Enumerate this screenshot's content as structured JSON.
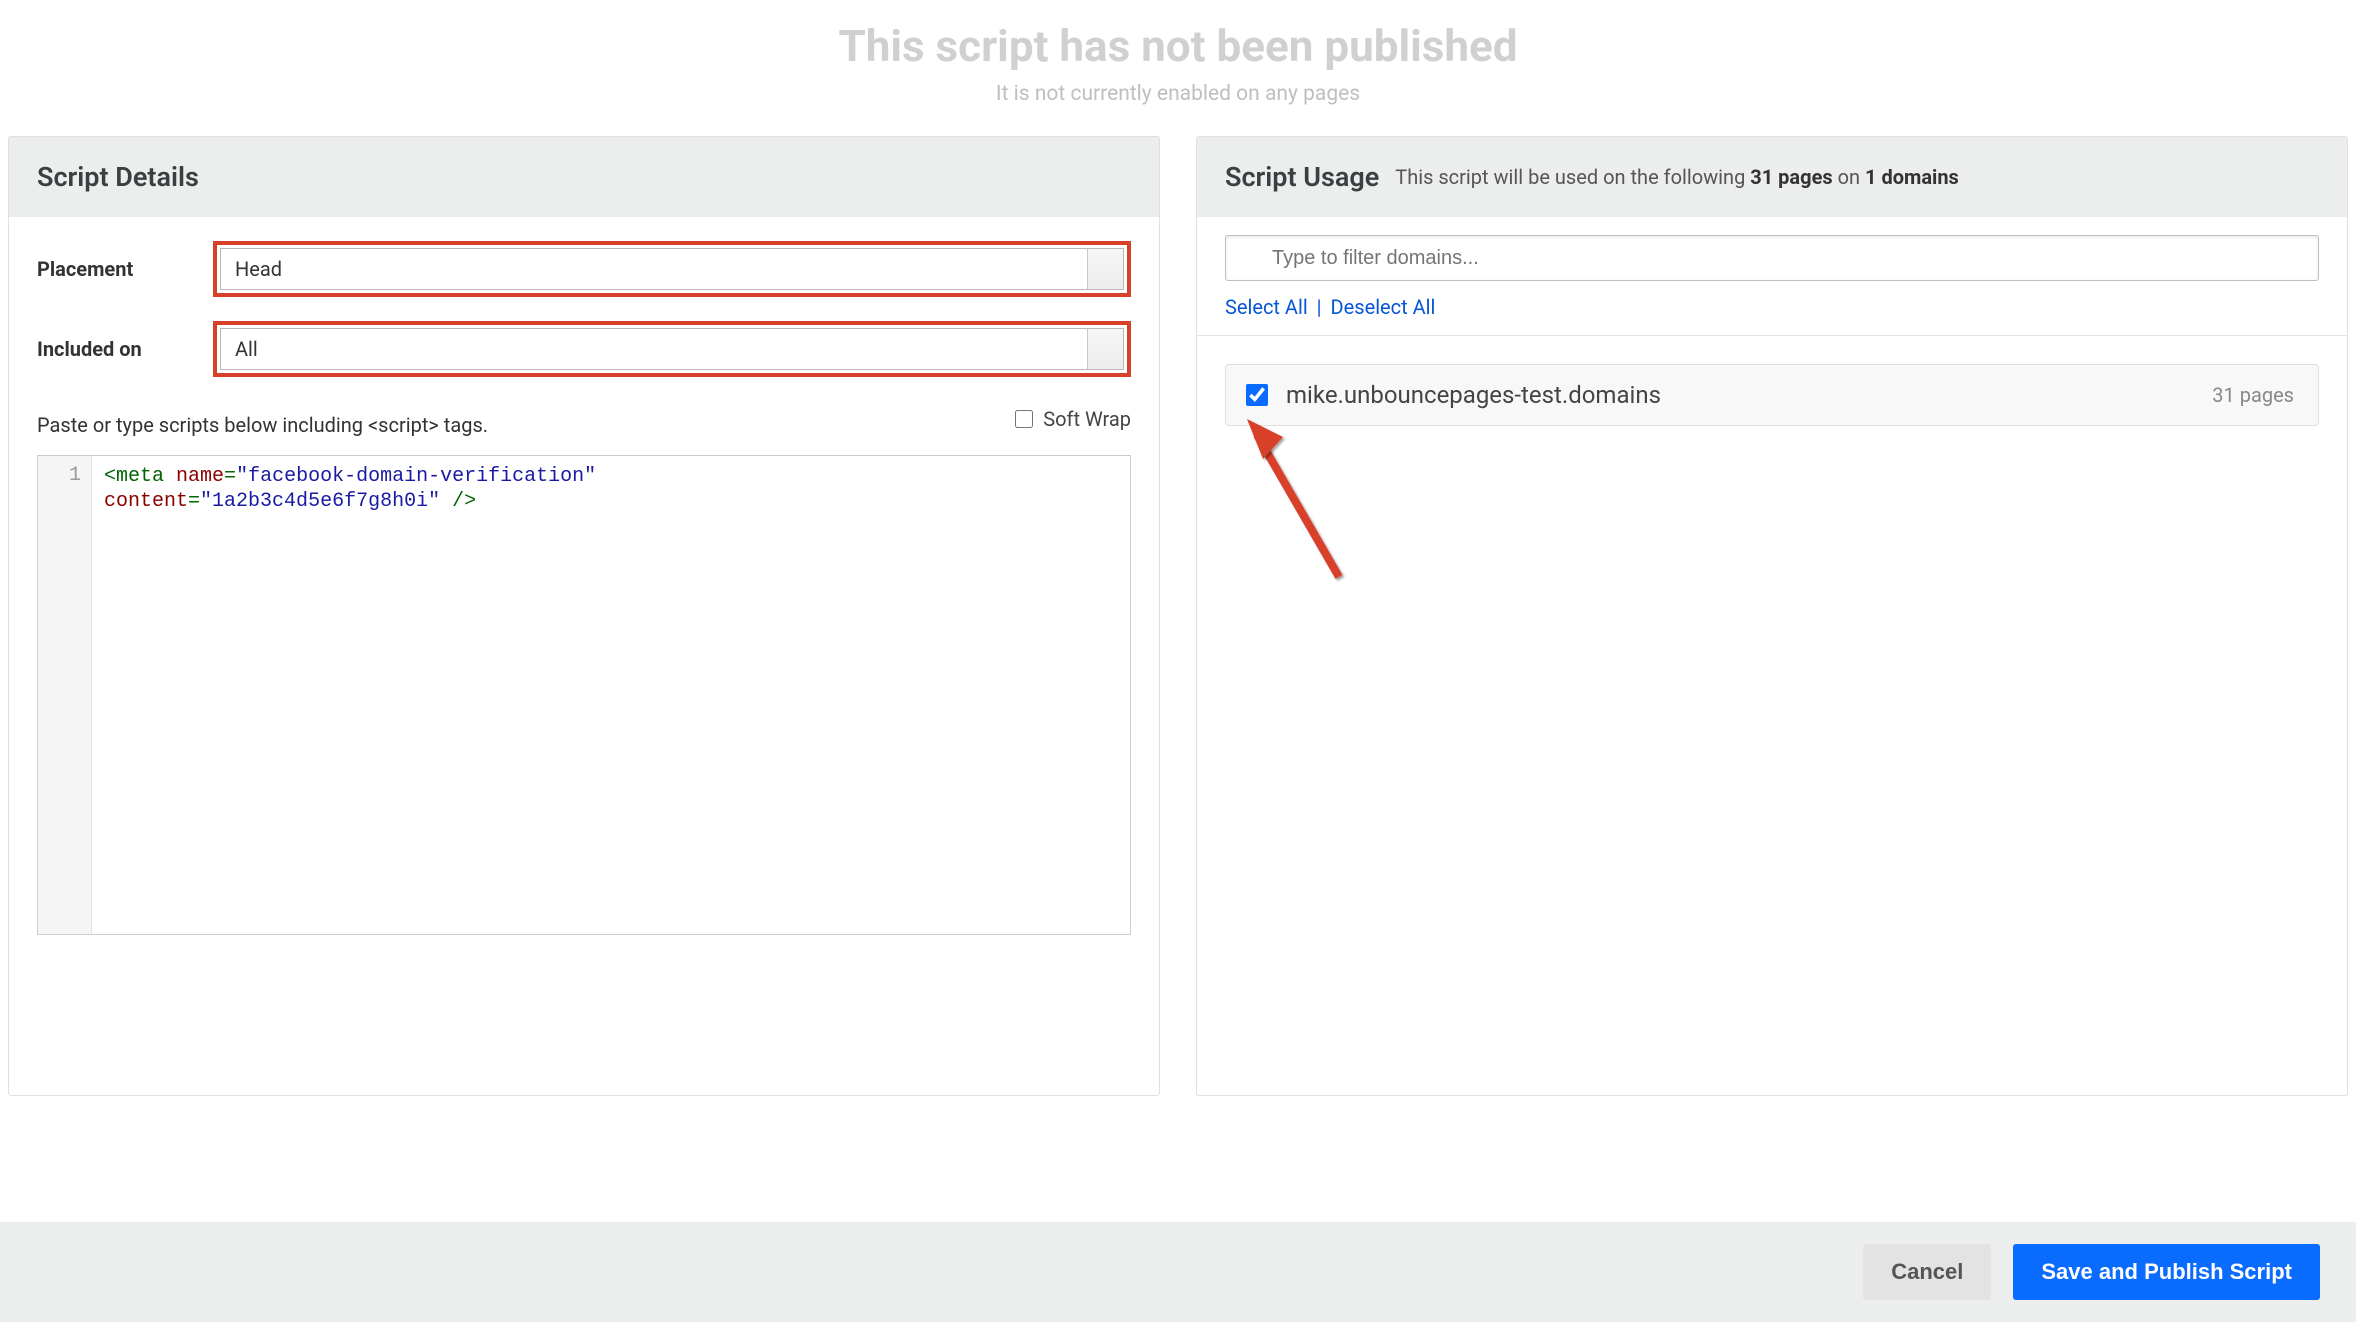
{
  "banner": {
    "title": "This script has not been published",
    "subtitle": "It is not currently enabled on any pages"
  },
  "details": {
    "title": "Script Details",
    "placement_label": "Placement",
    "placement_value": "Head",
    "included_label": "Included on",
    "included_value": "All",
    "instruction": "Paste or type scripts below including <script> tags.",
    "softwrap_label": "Soft Wrap",
    "code": {
      "line_number": "1",
      "attr_name_1": "name",
      "attr_val_1": "facebook-domain-verification",
      "attr_name_2": "content",
      "attr_val_2": "1a2b3c4d5e6f7g8h0i"
    }
  },
  "usage": {
    "title": "Script Usage",
    "desc_prefix": "This script will be used on the following ",
    "pages_count": "31 pages",
    "desc_mid": " on ",
    "domains_count": "1 domains",
    "filter_placeholder": "Type to filter domains...",
    "select_all": "Select All",
    "deselect_all": "Deselect All",
    "domain": {
      "name": "mike.unbouncepages-test.domains",
      "pages": "31 pages"
    }
  },
  "footer": {
    "cancel": "Cancel",
    "publish": "Save and Publish Script"
  }
}
